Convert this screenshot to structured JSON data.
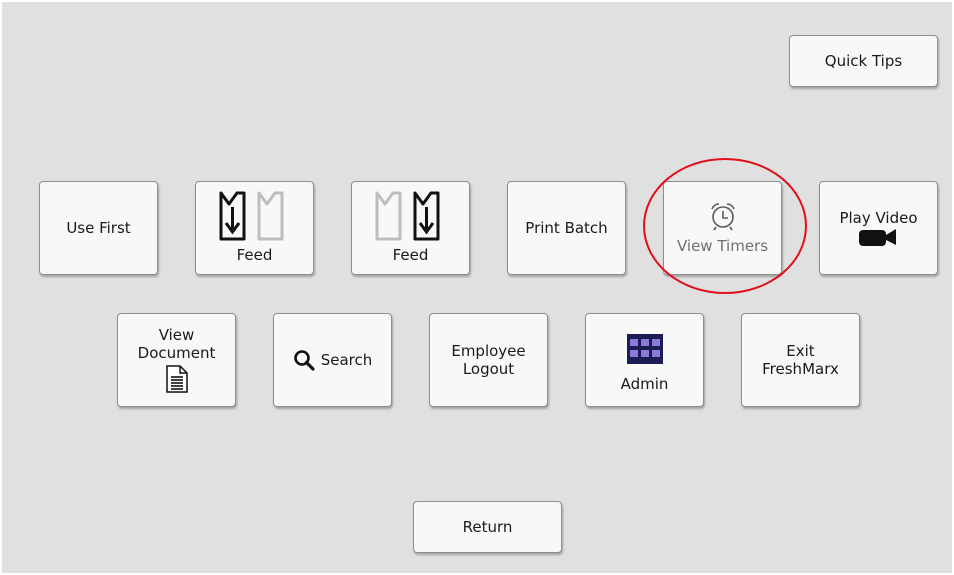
{
  "header": {
    "quick_tips_label": "Quick Tips"
  },
  "row1": {
    "use_first_label": "Use First",
    "feed_left_label": "Feed",
    "feed_right_label": "Feed",
    "print_batch_label": "Print Batch",
    "view_timers_label": "View Timers",
    "play_video_label": "Play Video"
  },
  "row2": {
    "view_document_label_1": "View",
    "view_document_label_2": "Document",
    "search_label": "Search",
    "employee_logout_label_1": "Employee",
    "employee_logout_label_2": "Logout",
    "admin_label": "Admin",
    "exit_label_1": "Exit",
    "exit_label_2": "FreshMarx"
  },
  "footer": {
    "return_label": "Return"
  },
  "icons": {
    "feed": "feed-arrow-icon",
    "timer": "alarm-clock-icon",
    "video": "video-camera-icon",
    "document": "document-icon",
    "search": "magnifier-icon",
    "admin": "admin-grid-icon"
  },
  "colors": {
    "highlight_ring": "#e0101a",
    "admin_icon": "#8c7ad8"
  }
}
